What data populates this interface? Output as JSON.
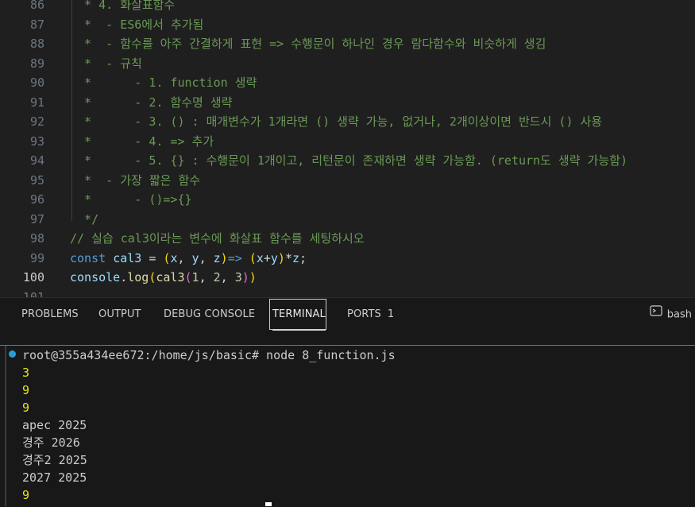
{
  "editor": {
    "lines": [
      {
        "num": "86",
        "segments": [
          {
            "cls": "c",
            "text": "  * 4. 화살표함수"
          }
        ]
      },
      {
        "num": "87",
        "segments": [
          {
            "cls": "c",
            "text": "  *  - ES6에서 추가됨"
          }
        ]
      },
      {
        "num": "88",
        "segments": [
          {
            "cls": "c",
            "text": "  *  - 함수를 아주 간결하게 표현 => 수행문이 하나인 경우 람다함수와 비슷하게 생김"
          }
        ]
      },
      {
        "num": "89",
        "segments": [
          {
            "cls": "c",
            "text": "  *  - 규칙"
          }
        ]
      },
      {
        "num": "90",
        "segments": [
          {
            "cls": "c",
            "text": "  *      - 1. function 생략"
          }
        ]
      },
      {
        "num": "91",
        "segments": [
          {
            "cls": "c",
            "text": "  *      - 2. 함수명 생략"
          }
        ]
      },
      {
        "num": "92",
        "segments": [
          {
            "cls": "c",
            "text": "  *      - 3. () : 매개변수가 1개라면 () 생략 가능, 없거나, 2개이상이면 반드시 () 사용"
          }
        ]
      },
      {
        "num": "93",
        "segments": [
          {
            "cls": "c",
            "text": "  *      - 4. => 추가"
          }
        ]
      },
      {
        "num": "94",
        "segments": [
          {
            "cls": "c",
            "text": "  *      - 5. {} : 수행문이 1개이고, 리턴문이 존재하면 생략 가능함. (return도 생략 가능함)"
          }
        ]
      },
      {
        "num": "95",
        "segments": [
          {
            "cls": "c",
            "text": "  *  - 가장 짧은 함수"
          }
        ]
      },
      {
        "num": "96",
        "segments": [
          {
            "cls": "c",
            "text": "  *      - ()=>{}"
          }
        ]
      },
      {
        "num": "97",
        "segments": [
          {
            "cls": "c",
            "text": "  */"
          }
        ]
      },
      {
        "num": "98",
        "segments": [
          {
            "cls": "c",
            "text": "// 실습 cal3이라는 변수에 화살표 함수를 세팅하시오"
          }
        ]
      },
      {
        "num": "99",
        "segments": [
          {
            "cls": "kw",
            "text": "const "
          },
          {
            "cls": "var",
            "text": "cal3"
          },
          {
            "cls": "txt",
            "text": " = "
          },
          {
            "cls": "p2",
            "text": "("
          },
          {
            "cls": "var",
            "text": "x"
          },
          {
            "cls": "txt",
            "text": ", "
          },
          {
            "cls": "var",
            "text": "y"
          },
          {
            "cls": "txt",
            "text": ", "
          },
          {
            "cls": "var",
            "text": "z"
          },
          {
            "cls": "p2",
            "text": ")"
          },
          {
            "cls": "kw",
            "text": "=>"
          },
          {
            "cls": "txt",
            "text": " "
          },
          {
            "cls": "p2",
            "text": "("
          },
          {
            "cls": "var",
            "text": "x"
          },
          {
            "cls": "txt",
            "text": "+"
          },
          {
            "cls": "var",
            "text": "y"
          },
          {
            "cls": "p2",
            "text": ")"
          },
          {
            "cls": "txt",
            "text": "*"
          },
          {
            "cls": "var",
            "text": "z"
          },
          {
            "cls": "txt",
            "text": ";"
          }
        ]
      },
      {
        "num": "100",
        "active": true,
        "segments": [
          {
            "cls": "var",
            "text": "console"
          },
          {
            "cls": "txt",
            "text": "."
          },
          {
            "cls": "fn",
            "text": "log"
          },
          {
            "cls": "p2",
            "text": "("
          },
          {
            "cls": "fn",
            "text": "cal3"
          },
          {
            "cls": "p1",
            "text": "("
          },
          {
            "cls": "num",
            "text": "1"
          },
          {
            "cls": "txt",
            "text": ", "
          },
          {
            "cls": "num",
            "text": "2"
          },
          {
            "cls": "txt",
            "text": ", "
          },
          {
            "cls": "num",
            "text": "3"
          },
          {
            "cls": "p1",
            "text": ")"
          },
          {
            "cls": "p2",
            "text": ")"
          }
        ]
      },
      {
        "num": "101",
        "segments": []
      }
    ]
  },
  "panel": {
    "tabs": [
      "PROBLEMS",
      "OUTPUT",
      "DEBUG CONSOLE",
      "TERMINAL",
      "PORTS"
    ],
    "ports_count": "1",
    "shell_label": "bash",
    "active_tab": "TERMINAL"
  },
  "terminal": {
    "prompt": "root@355a434ee672:/home/js/basic# node 8_function.js",
    "output": [
      {
        "text": "3",
        "yellow": true
      },
      {
        "text": "9",
        "yellow": true
      },
      {
        "text": "9",
        "yellow": true
      },
      {
        "text": "apec 2025",
        "yellow": false
      },
      {
        "text": "경주 2026",
        "yellow": false
      },
      {
        "text": "경주2 2025",
        "yellow": false
      },
      {
        "text": "2027 2025",
        "yellow": false
      },
      {
        "text": "9",
        "yellow": true
      }
    ]
  },
  "colors": {
    "comment": "#6a9955",
    "keyword": "#569cd6",
    "terminal_yellow": "#e5e510",
    "panel_border": "#c75b3a"
  }
}
